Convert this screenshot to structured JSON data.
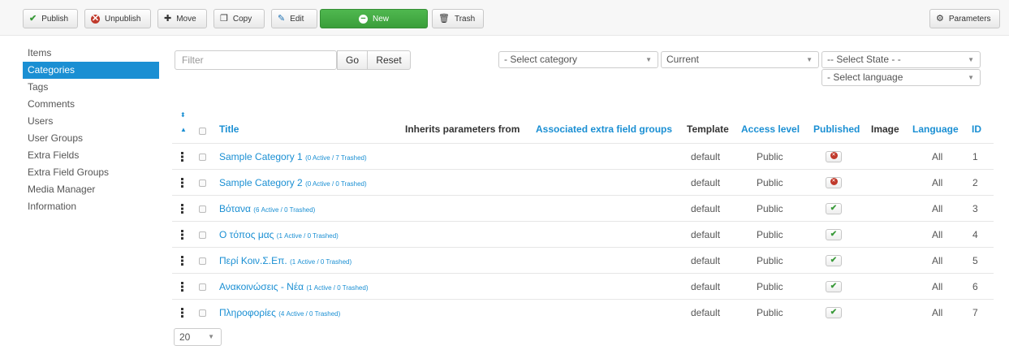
{
  "toolbar": {
    "publish": "Publish",
    "unpublish": "Unpublish",
    "move": "Move",
    "copy": "Copy",
    "edit": "Edit",
    "new": "New",
    "trash": "Trash",
    "parameters": "Parameters"
  },
  "sidebar": {
    "items": [
      {
        "label": "Items"
      },
      {
        "label": "Categories",
        "active": true
      },
      {
        "label": "Tags"
      },
      {
        "label": "Comments"
      },
      {
        "label": "Users"
      },
      {
        "label": "User Groups"
      },
      {
        "label": "Extra Fields"
      },
      {
        "label": "Extra Field Groups"
      },
      {
        "label": "Media Manager"
      },
      {
        "label": "Information"
      }
    ]
  },
  "filters": {
    "filter_placeholder": "Filter",
    "go": "Go",
    "reset": "Reset",
    "category": "- Select category",
    "current": "Current",
    "state": "-- Select State - -",
    "language": "- Select language"
  },
  "table": {
    "headers": {
      "title": "Title",
      "inherits": "Inherits parameters from",
      "extra_groups": "Associated extra field groups",
      "template": "Template",
      "access": "Access level",
      "published": "Published",
      "image": "Image",
      "language": "Language",
      "id": "ID"
    },
    "rows": [
      {
        "title": "Sample Category 1",
        "counts": "(0 Active / 7 Trashed)",
        "template": "default",
        "access": "Public",
        "published": false,
        "language": "All",
        "id": "1"
      },
      {
        "title": "Sample Category 2",
        "counts": "(0 Active / 0 Trashed)",
        "template": "default",
        "access": "Public",
        "published": false,
        "language": "All",
        "id": "2"
      },
      {
        "title": "Βότανα",
        "counts": "(6 Active / 0 Trashed)",
        "template": "default",
        "access": "Public",
        "published": true,
        "language": "All",
        "id": "3"
      },
      {
        "title": "Ο τόπος μας",
        "counts": "(1 Active / 0 Trashed)",
        "template": "default",
        "access": "Public",
        "published": true,
        "language": "All",
        "id": "4"
      },
      {
        "title": "Περί Κοιν.Σ.Επ.",
        "counts": "(1 Active / 0 Trashed)",
        "template": "default",
        "access": "Public",
        "published": true,
        "language": "All",
        "id": "5"
      },
      {
        "title": "Ανακοινώσεις - Νέα",
        "counts": "(1 Active / 0 Trashed)",
        "template": "default",
        "access": "Public",
        "published": true,
        "language": "All",
        "id": "6"
      },
      {
        "title": "Πληροφορίες",
        "counts": "(4 Active / 0 Trashed)",
        "template": "default",
        "access": "Public",
        "published": true,
        "language": "All",
        "id": "7"
      }
    ]
  },
  "pager": {
    "limit": "20"
  },
  "colors": {
    "accent": "#1a8fd3",
    "new_button": "#3a9e3a",
    "unpublished": "#c0392b"
  }
}
